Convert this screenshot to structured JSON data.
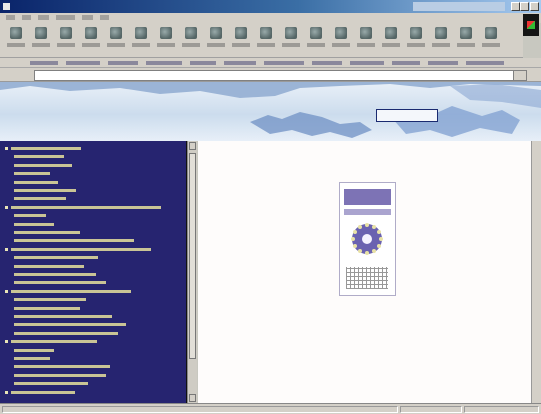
{
  "window": {
    "title": ""
  },
  "menu": {
    "items": [
      "",
      "",
      "",
      "",
      "",
      ""
    ]
  },
  "toolbar": {
    "buttons": [
      "back-icon",
      "forward-icon",
      "stop-icon",
      "refresh-icon",
      "home-icon",
      "search-icon",
      "favorites-icon",
      "history-icon",
      "mail-icon",
      "print-icon",
      "edit-icon",
      "discuss-icon",
      "messenger-icon",
      "media-icon",
      "folder-icon",
      "tools-icon",
      "translate-icon",
      "help-icon",
      "size-icon",
      "fullscreen-icon"
    ]
  },
  "address": {
    "url": ""
  },
  "banner": {
    "title": ""
  },
  "sidebar": {
    "items": [
      {
        "label": "",
        "level": 0
      },
      {
        "label": "",
        "level": 1
      },
      {
        "label": "",
        "level": 1
      },
      {
        "label": "",
        "level": 1
      },
      {
        "label": "",
        "level": 1
      },
      {
        "label": "",
        "level": 1
      },
      {
        "label": "",
        "level": 1
      },
      {
        "label": "",
        "level": 0
      },
      {
        "label": "",
        "level": 1
      },
      {
        "label": "",
        "level": 1
      },
      {
        "label": "",
        "level": 1
      },
      {
        "label": "",
        "level": 1
      },
      {
        "label": "",
        "level": 0
      },
      {
        "label": "",
        "level": 1
      },
      {
        "label": "",
        "level": 1
      },
      {
        "label": "",
        "level": 1
      },
      {
        "label": "",
        "level": 1
      },
      {
        "label": "",
        "level": 0
      },
      {
        "label": "",
        "level": 1
      },
      {
        "label": "",
        "level": 1
      },
      {
        "label": "",
        "level": 1
      },
      {
        "label": "",
        "level": 1
      },
      {
        "label": "",
        "level": 1
      },
      {
        "label": "",
        "level": 0
      },
      {
        "label": "",
        "level": 1
      },
      {
        "label": "",
        "level": 1
      },
      {
        "label": "",
        "level": 1
      },
      {
        "label": "",
        "level": 1
      },
      {
        "label": "",
        "level": 1
      },
      {
        "label": "",
        "level": 0
      }
    ]
  },
  "content": {
    "caption": "",
    "text_lines": [
      "",
      "",
      ""
    ]
  },
  "status": {
    "left": "",
    "zone": ""
  },
  "colors": {
    "sidebar_bg": "#262470",
    "sidebar_text": "#dcd69a",
    "emblem_blue": "#7d73b5",
    "title_blue": "#0a246a"
  }
}
